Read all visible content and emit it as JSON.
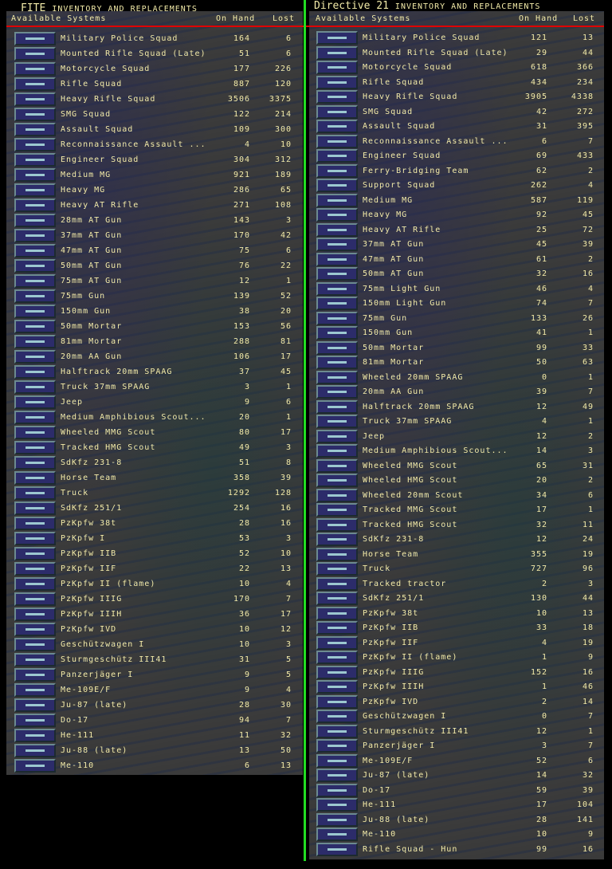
{
  "left": {
    "title_app": "FITE",
    "title": "INVENTORY AND REPLACEMENTS",
    "col_systems": "Available Systems",
    "col_onhand": "On Hand",
    "col_lost": "Lost",
    "rows": [
      [
        "Military Police Squad",
        "164",
        "6"
      ],
      [
        "Mounted Rifle Squad (Late)",
        "51",
        "6"
      ],
      [
        "Motorcycle Squad",
        "177",
        "226"
      ],
      [
        "Rifle Squad",
        "887",
        "120"
      ],
      [
        "Heavy Rifle Squad",
        "3506",
        "3375"
      ],
      [
        "SMG Squad",
        "122",
        "214"
      ],
      [
        "Assault Squad",
        "109",
        "300"
      ],
      [
        "Reconnaissance Assault ...",
        "4",
        "10"
      ],
      [
        "Engineer Squad",
        "304",
        "312"
      ],
      [
        "Medium MG",
        "921",
        "189"
      ],
      [
        "Heavy MG",
        "286",
        "65"
      ],
      [
        "Heavy AT Rifle",
        "271",
        "108"
      ],
      [
        "28mm AT Gun",
        "143",
        "3"
      ],
      [
        "37mm AT Gun",
        "170",
        "42"
      ],
      [
        "47mm AT Gun",
        "75",
        "6"
      ],
      [
        "50mm AT Gun",
        "76",
        "22"
      ],
      [
        "75mm AT Gun",
        "12",
        "1"
      ],
      [
        "75mm Gun",
        "139",
        "52"
      ],
      [
        "150mm Gun",
        "38",
        "20"
      ],
      [
        "50mm Mortar",
        "153",
        "56"
      ],
      [
        "81mm Mortar",
        "288",
        "81"
      ],
      [
        "20mm AA Gun",
        "106",
        "17"
      ],
      [
        "Halftrack 20mm SPAAG",
        "37",
        "45"
      ],
      [
        "Truck 37mm SPAAG",
        "3",
        "1"
      ],
      [
        "Jeep",
        "9",
        "6"
      ],
      [
        "Medium Amphibious Scout...",
        "20",
        "1"
      ],
      [
        "Wheeled MMG Scout",
        "80",
        "17"
      ],
      [
        "Tracked HMG Scout",
        "49",
        "3"
      ],
      [
        "SdKfz 231-8",
        "51",
        "8"
      ],
      [
        "Horse Team",
        "358",
        "39"
      ],
      [
        "Truck",
        "1292",
        "128"
      ],
      [
        "SdKfz 251/1",
        "254",
        "16"
      ],
      [
        "PzKpfw 38t",
        "28",
        "16"
      ],
      [
        "PzKpfw I",
        "53",
        "3"
      ],
      [
        "PzKpfw IIB",
        "52",
        "10"
      ],
      [
        "PzKpfw IIF",
        "22",
        "13"
      ],
      [
        "PzKpfw II (flame)",
        "10",
        "4"
      ],
      [
        "PzKpfw IIIG",
        "170",
        "7"
      ],
      [
        "PzKpfw IIIH",
        "36",
        "17"
      ],
      [
        "PzKpfw IVD",
        "10",
        "12"
      ],
      [
        "Geschützwagen I",
        "10",
        "3"
      ],
      [
        "Sturmgeschütz III41",
        "31",
        "5"
      ],
      [
        "Panzerjäger I",
        "9",
        "5"
      ],
      [
        "Me-109E/F",
        "9",
        "4"
      ],
      [
        "Ju-87 (late)",
        "28",
        "30"
      ],
      [
        "Do-17",
        "94",
        "7"
      ],
      [
        "He-111",
        "11",
        "32"
      ],
      [
        "Ju-88 (late)",
        "13",
        "50"
      ],
      [
        "Me-110",
        "6",
        "13"
      ]
    ]
  },
  "right": {
    "title_app": "Directive 21",
    "title": "INVENTORY AND REPLACEMENTS",
    "col_systems": "Available Systems",
    "col_onhand": "On Hand",
    "col_lost": "Lost",
    "rows": [
      [
        "Military Police Squad",
        "121",
        "13"
      ],
      [
        "Mounted Rifle Squad (Late)",
        "29",
        "44"
      ],
      [
        "Motorcycle Squad",
        "618",
        "366"
      ],
      [
        "Rifle Squad",
        "434",
        "234"
      ],
      [
        "Heavy Rifle Squad",
        "3905",
        "4338"
      ],
      [
        "SMG Squad",
        "42",
        "272"
      ],
      [
        "Assault Squad",
        "31",
        "395"
      ],
      [
        "Reconnaissance Assault ...",
        "6",
        "7"
      ],
      [
        "Engineer Squad",
        "69",
        "433"
      ],
      [
        "Ferry-Bridging Team",
        "62",
        "2"
      ],
      [
        "Support Squad",
        "262",
        "4"
      ],
      [
        "Medium MG",
        "587",
        "119"
      ],
      [
        "Heavy MG",
        "92",
        "45"
      ],
      [
        "Heavy AT Rifle",
        "25",
        "72"
      ],
      [
        "37mm AT Gun",
        "45",
        "39"
      ],
      [
        "47mm AT Gun",
        "61",
        "2"
      ],
      [
        "50mm AT Gun",
        "32",
        "16"
      ],
      [
        "75mm Light Gun",
        "46",
        "4"
      ],
      [
        "150mm Light Gun",
        "74",
        "7"
      ],
      [
        "75mm Gun",
        "133",
        "26"
      ],
      [
        "150mm Gun",
        "41",
        "1"
      ],
      [
        "50mm Mortar",
        "99",
        "33"
      ],
      [
        "81mm Mortar",
        "50",
        "63"
      ],
      [
        "Wheeled 20mm SPAAG",
        "0",
        "1"
      ],
      [
        "20mm AA Gun",
        "39",
        "7"
      ],
      [
        "Halftrack 20mm SPAAG",
        "12",
        "49"
      ],
      [
        "Truck 37mm SPAAG",
        "4",
        "1"
      ],
      [
        "Jeep",
        "12",
        "2"
      ],
      [
        "Medium Amphibious Scout...",
        "14",
        "3"
      ],
      [
        "Wheeled MMG Scout",
        "65",
        "31"
      ],
      [
        "Wheeled HMG Scout",
        "20",
        "2"
      ],
      [
        "Wheeled 20mm Scout",
        "34",
        "6"
      ],
      [
        "Tracked MMG Scout",
        "17",
        "1"
      ],
      [
        "Tracked HMG Scout",
        "32",
        "11"
      ],
      [
        "SdKfz 231-8",
        "12",
        "24"
      ],
      [
        "Horse Team",
        "355",
        "19"
      ],
      [
        "Truck",
        "727",
        "96"
      ],
      [
        "Tracked tractor",
        "2",
        "3"
      ],
      [
        "SdKfz 251/1",
        "130",
        "44"
      ],
      [
        "PzKpfw 38t",
        "10",
        "13"
      ],
      [
        "PzKpfw IIB",
        "33",
        "18"
      ],
      [
        "PzKpfw IIF",
        "4",
        "19"
      ],
      [
        "PzKpfw II (flame)",
        "1",
        "9"
      ],
      [
        "PzKpfw IIIG",
        "152",
        "16"
      ],
      [
        "PzKpfw IIIH",
        "1",
        "46"
      ],
      [
        "PzKpfw IVD",
        "2",
        "14"
      ],
      [
        "Geschützwagen I",
        "0",
        "7"
      ],
      [
        "Sturmgeschütz III41",
        "12",
        "1"
      ],
      [
        "Panzerjäger I",
        "3",
        "7"
      ],
      [
        "Me-109E/F",
        "52",
        "6"
      ],
      [
        "Ju-87 (late)",
        "14",
        "32"
      ],
      [
        "Do-17",
        "59",
        "39"
      ],
      [
        "He-111",
        "17",
        "104"
      ],
      [
        "Ju-88 (late)",
        "28",
        "141"
      ],
      [
        "Me-110",
        "10",
        "9"
      ],
      [
        "Rifle Squad - Hun",
        "99",
        "16"
      ]
    ]
  }
}
